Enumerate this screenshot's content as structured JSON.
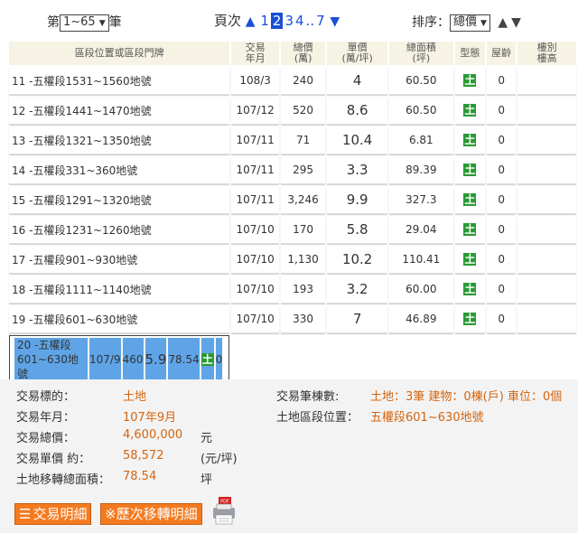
{
  "top": {
    "prefix": "第",
    "range_value": "1~65",
    "suffix": "筆",
    "page_label": "頁次",
    "pages": [
      "1",
      "2",
      "3",
      "4",
      "..",
      "7"
    ],
    "current_page": "2",
    "sort_label": "排序：",
    "sort_value": "總價"
  },
  "table": {
    "headers": [
      "區段位置或區段門牌",
      "交易\n年月",
      "總價\n(萬)",
      "單價\n(萬/坪)",
      "總面積\n(坪)",
      "型態",
      "屋齡",
      "樓別\n樓高"
    ],
    "rows": [
      {
        "no": "11",
        "loc": "-五權段1531~1560地號",
        "ym": "108/3",
        "total": "240",
        "unit": "4",
        "area": "60.50",
        "age": "0"
      },
      {
        "no": "12",
        "loc": "-五權段1441~1470地號",
        "ym": "107/12",
        "total": "520",
        "unit": "8.6",
        "area": "60.50",
        "age": "0"
      },
      {
        "no": "13",
        "loc": "-五權段1321~1350地號",
        "ym": "107/11",
        "total": "71",
        "unit": "10.4",
        "area": "6.81",
        "age": "0"
      },
      {
        "no": "14",
        "loc": "-五權段331~360地號",
        "ym": "107/11",
        "total": "295",
        "unit": "3.3",
        "area": "89.39",
        "age": "0"
      },
      {
        "no": "15",
        "loc": "-五權段1291~1320地號",
        "ym": "107/11",
        "total": "3,246",
        "unit": "9.9",
        "area": "327.3",
        "age": "0"
      },
      {
        "no": "16",
        "loc": "-五權段1231~1260地號",
        "ym": "107/10",
        "total": "170",
        "unit": "5.8",
        "area": "29.04",
        "age": "0"
      },
      {
        "no": "17",
        "loc": "-五權段901~930地號",
        "ym": "107/10",
        "total": "1,130",
        "unit": "10.2",
        "area": "110.41",
        "age": "0"
      },
      {
        "no": "18",
        "loc": "-五權段1111~1140地號",
        "ym": "107/10",
        "total": "193",
        "unit": "3.2",
        "area": "60.00",
        "age": "0"
      },
      {
        "no": "19",
        "loc": "-五權段601~630地號",
        "ym": "107/10",
        "total": "330",
        "unit": "7",
        "area": "46.89",
        "age": "0"
      },
      {
        "no": "20",
        "loc": "-五權段601~630地號",
        "ym": "107/9",
        "total": "460",
        "unit": "5.9",
        "area": "78.54",
        "age": "0"
      }
    ],
    "type_icon": "土"
  },
  "detail": {
    "target_label": "交易標的：",
    "target_value": "土地",
    "ym_label": "交易年月：",
    "ym_value": "107年9月",
    "total_label": "交易總價：",
    "total_value": "4,600,000",
    "total_unit": "元",
    "unit_label": "交易單價 約：",
    "unit_value": "58,572",
    "unit_unit": "(元/坪)",
    "area_label": "土地移轉總面積：",
    "area_value": "78.54",
    "area_unit": "坪",
    "count_label": "交易筆棟數:",
    "count_value": "土地：3筆 建物：0棟(戶) 車位：0個",
    "section_label": "土地區段位置：",
    "section_value": "五權段601~630地號"
  },
  "buttons": {
    "detail_label": "交易明細",
    "history_label": "※歷次移轉明細"
  },
  "colors": {
    "accent": "#1a4fd6",
    "selected_row": "#5fa4e7",
    "value_text": "#d4650f",
    "button": "#f47a1f",
    "type_icon": "#2a9a34"
  }
}
